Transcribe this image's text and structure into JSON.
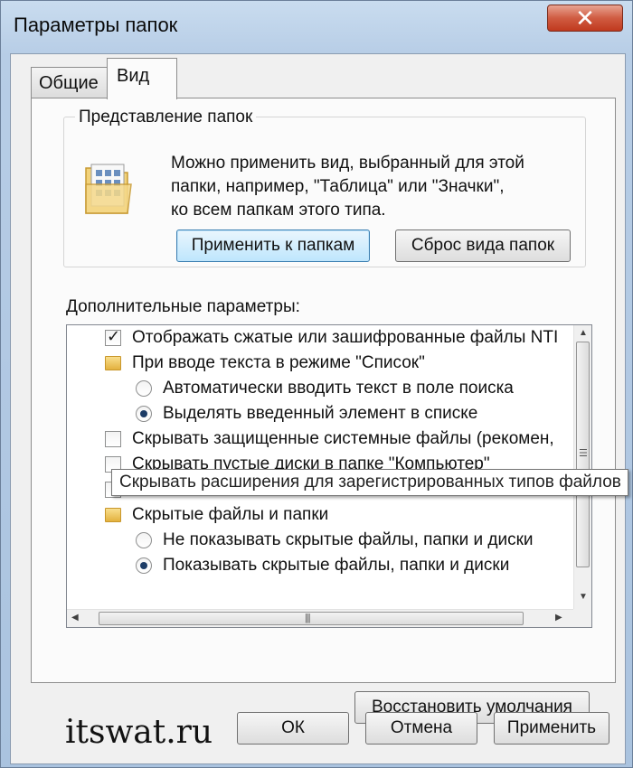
{
  "window": {
    "title": "Параметры папок"
  },
  "tabs": [
    {
      "label": "Общие"
    },
    {
      "label": "Вид"
    }
  ],
  "folder_views": {
    "group_label": "Представление папок",
    "description_lines": [
      "Можно применить вид, выбранный для этой",
      "папки, например, \"Таблица\" или \"Значки\",",
      "ко всем папкам этого типа."
    ],
    "apply_button": "Применить к папкам",
    "reset_button": "Сброс вида папок"
  },
  "advanced": {
    "label": "Дополнительные параметры:",
    "items": [
      {
        "type": "checkbox",
        "checked": true,
        "label": "Отображать сжатые или зашифрованные файлы NTI"
      },
      {
        "type": "folder",
        "label": "При вводе текста в режиме \"Список\""
      },
      {
        "type": "radio",
        "checked": false,
        "label": "Автоматически вводить текст в поле поиска"
      },
      {
        "type": "radio",
        "checked": true,
        "label": "Выделять введенный элемент в списке"
      },
      {
        "type": "checkbox",
        "checked": false,
        "label": "Скрывать защищенные системные файлы (рекомен,"
      },
      {
        "type": "checkbox",
        "checked": false,
        "label": "Скрывать пустые диски в папке \"Компьютер\""
      },
      {
        "type": "checkbox",
        "checked": false,
        "label": ""
      },
      {
        "type": "folder",
        "label": "Скрытые файлы и папки"
      },
      {
        "type": "radio",
        "checked": false,
        "label": "Не показывать скрытые файлы, папки и диски"
      },
      {
        "type": "radio",
        "checked": true,
        "label": "Показывать скрытые файлы, папки и диски"
      }
    ],
    "tooltip": "Скрывать расширения для зарегистрированных типов файлов"
  },
  "buttons": {
    "restore": "Восстановить умолчания",
    "ok": "ОК",
    "cancel": "Отмена",
    "apply": "Применить"
  },
  "watermark": "itswat.ru"
}
